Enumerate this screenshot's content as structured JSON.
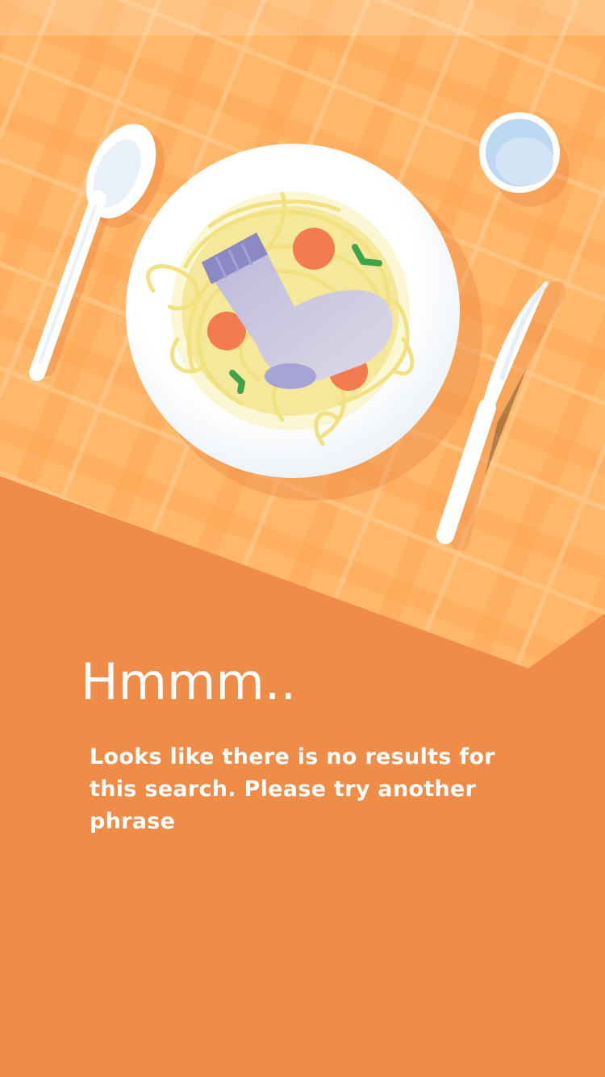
{
  "empty_state": {
    "heading": "Hmmm..",
    "message": "Looks like there is no results for this search. Please try another phrase"
  },
  "illustration": {
    "subject": "plate of spaghetti with a sock, spoon, knife and glass of water on a checkered tablecloth"
  },
  "colors": {
    "background": "#EE8C48",
    "tablecloth": "#FFB566",
    "plate": "#FFFFFF",
    "pasta": "#F4E58A",
    "sock": "#A7A5D0",
    "tomato": "#F47A52",
    "herb": "#3FA34A",
    "water": "#C9DFF4"
  }
}
